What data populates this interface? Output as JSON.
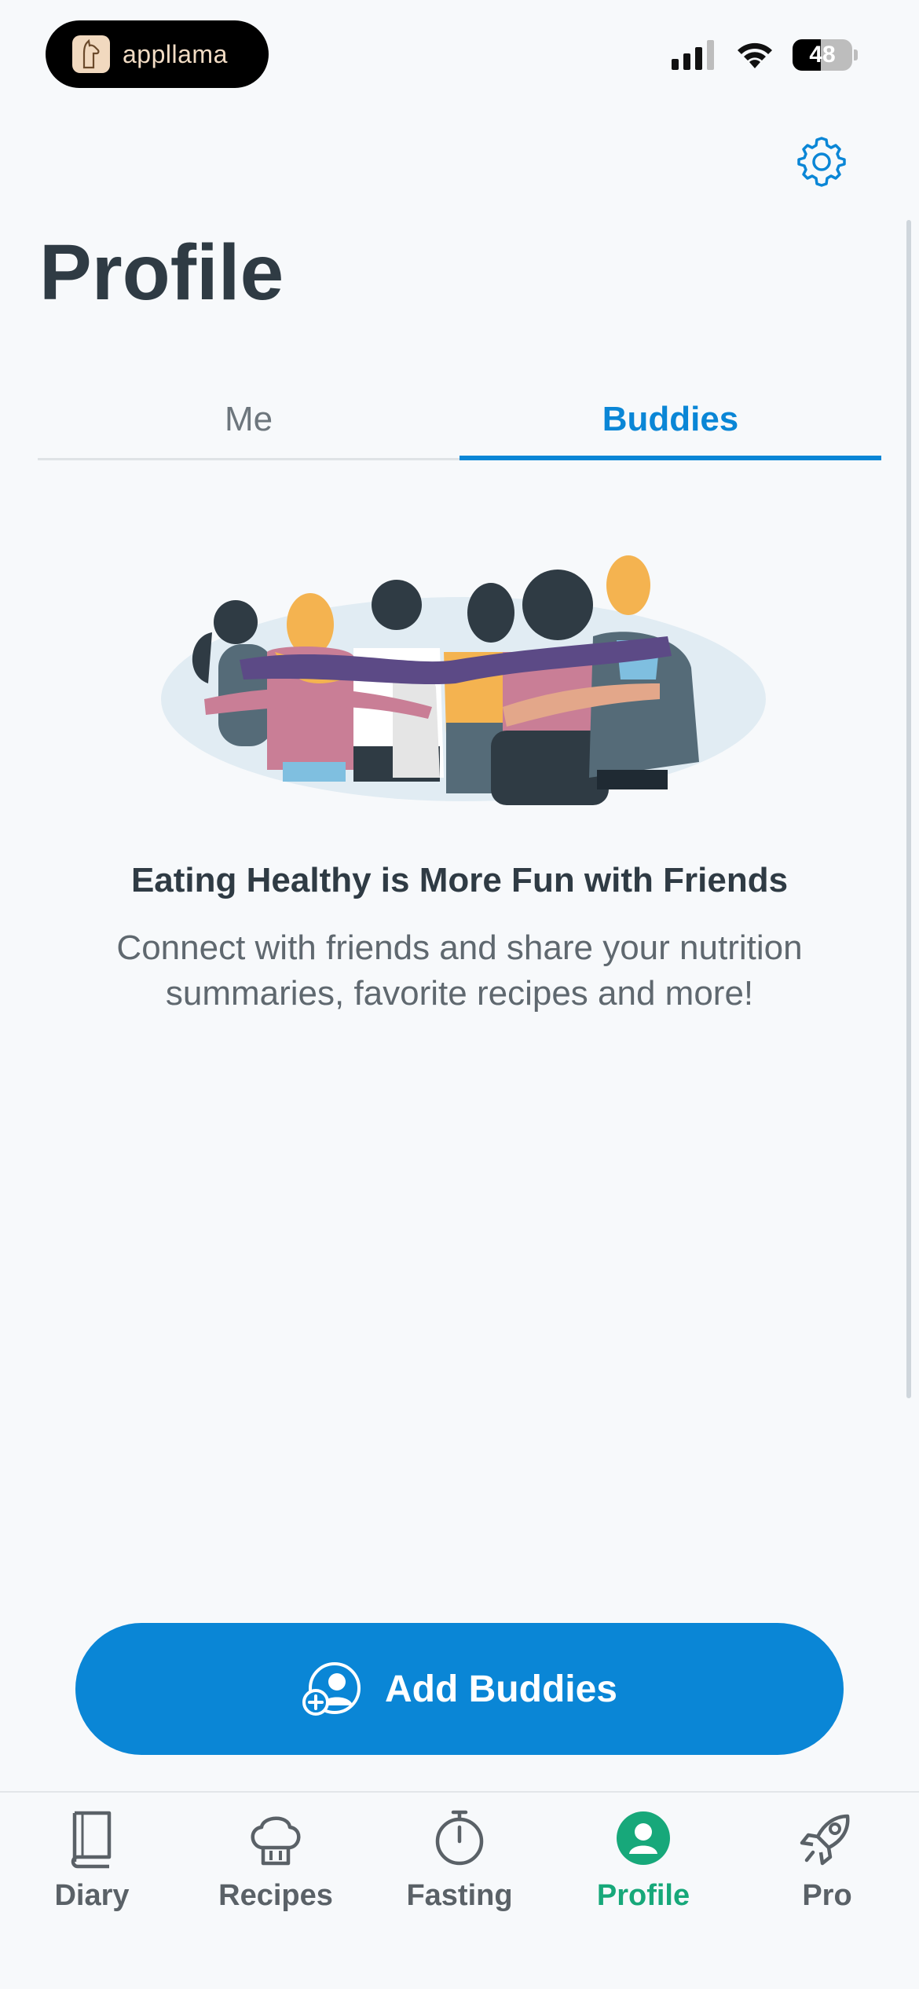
{
  "status_bar": {
    "pill_app_name": "appllama",
    "battery_level": "48",
    "battery_fraction": 0.48
  },
  "header": {
    "title": "Profile"
  },
  "tabs": [
    {
      "label": "Me",
      "active": false
    },
    {
      "label": "Buddies",
      "active": true
    }
  ],
  "empty_state": {
    "headline": "Eating Healthy is More Fun with Friends",
    "description": "Connect with friends and share your nutrition summaries, favorite recipes and more!"
  },
  "actions": {
    "add_buddies_label": "Add Buddies"
  },
  "tab_bar": [
    {
      "label": "Diary",
      "icon": "book-icon",
      "active": false
    },
    {
      "label": "Recipes",
      "icon": "chef-hat-icon",
      "active": false
    },
    {
      "label": "Fasting",
      "icon": "stopwatch-icon",
      "active": false
    },
    {
      "label": "Profile",
      "icon": "person-icon",
      "active": true
    },
    {
      "label": "Pro",
      "icon": "rocket-icon",
      "active": false
    }
  ],
  "colors": {
    "accent_blue": "#0a86d6",
    "active_green": "#17a87a",
    "text_dark": "#2f3b44",
    "background": "#f7f9fb"
  }
}
